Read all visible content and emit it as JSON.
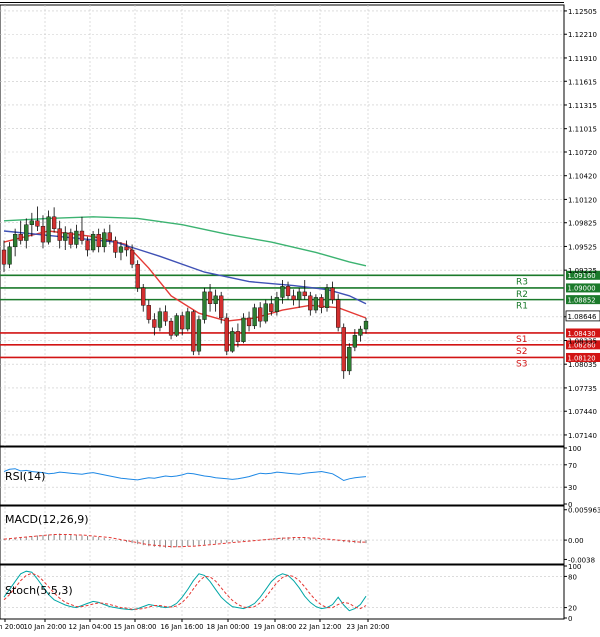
{
  "colors": {
    "frame": "#000000",
    "grid": "#c8c8c8",
    "bull": "#2e7d32",
    "bear": "#d32f2f",
    "wick": "#000000",
    "ma_red": "#e53935",
    "ma_blue": "#3f51b5",
    "ma_green": "#3cb371",
    "resistance": "#1b7a2b",
    "support": "#d21414",
    "rsi_line": "#1e88e5",
    "macd_signal": "#e53935",
    "macd_hist": "#888888",
    "stoch_k": "#00a6a6",
    "stoch_d": "#e53935"
  },
  "chart_data": [
    {
      "type": "candlestick",
      "panel": "price",
      "y_ticks": [
        "1.12505",
        "1.12210",
        "1.11910",
        "1.11615",
        "1.11315",
        "1.11015",
        "1.10720",
        "1.10420",
        "1.10120",
        "1.09825",
        "1.09525",
        "1.09225",
        "1.08635",
        "1.08335",
        "1.08035",
        "1.07735",
        "1.07440",
        "1.07140"
      ],
      "ylim": [
        1.07,
        1.1258
      ],
      "x_ticks": [
        "9 Jan 20:00",
        "10 Jan 20:00",
        "12 Jan 04:00",
        "15 Jan 08:00",
        "16 Jan 16:00",
        "18 Jan 00:00",
        "19 Jan 08:00",
        "22 Jan 12:00",
        "23 Jan 20:00"
      ],
      "candles": [
        [
          1.0948,
          1.096,
          1.092,
          1.093
        ],
        [
          1.093,
          1.0958,
          1.0925,
          1.0952
        ],
        [
          1.0952,
          1.0975,
          1.094,
          1.0968
        ],
        [
          1.0968,
          1.0985,
          1.0955,
          1.096
        ],
        [
          1.096,
          1.0988,
          1.095,
          1.098
        ],
        [
          1.098,
          1.0995,
          1.0965,
          1.0985
        ],
        [
          1.0985,
          1.1003,
          1.0972,
          1.0978
        ],
        [
          1.0978,
          1.0992,
          1.095,
          1.0958
        ],
        [
          1.0958,
          1.0998,
          1.0955,
          1.099
        ],
        [
          1.099,
          1.1002,
          1.097,
          1.0975
        ],
        [
          1.0975,
          1.0985,
          1.095,
          1.096
        ],
        [
          1.096,
          1.0978,
          1.0948,
          1.097
        ],
        [
          1.097,
          1.0975,
          1.095,
          1.0955
        ],
        [
          1.0955,
          1.098,
          1.095,
          1.0972
        ],
        [
          1.0972,
          1.099,
          1.0955,
          1.096
        ],
        [
          1.096,
          1.0965,
          1.094,
          1.0948
        ],
        [
          1.0948,
          1.0972,
          1.0945,
          1.0968
        ],
        [
          1.0968,
          1.0975,
          1.0945,
          1.0952
        ],
        [
          1.0952,
          1.0975,
          1.0945,
          1.097
        ],
        [
          1.097,
          1.098,
          1.0955,
          1.096
        ],
        [
          1.096,
          1.0965,
          1.0938,
          1.0945
        ],
        [
          1.0945,
          1.0958,
          1.0935,
          1.0952
        ],
        [
          1.0952,
          1.096,
          1.094,
          1.0948
        ],
        [
          1.0948,
          1.0955,
          1.0925,
          1.093
        ],
        [
          1.093,
          1.0935,
          1.0895,
          1.09
        ],
        [
          1.09,
          1.0905,
          1.087,
          1.0878
        ],
        [
          1.0878,
          1.0885,
          1.0855,
          1.086
        ],
        [
          1.086,
          1.0868,
          1.084,
          1.085
        ],
        [
          1.085,
          1.0875,
          1.0845,
          1.087
        ],
        [
          1.087,
          1.0878,
          1.0852,
          1.0858
        ],
        [
          1.0858,
          1.0862,
          1.0835,
          1.084
        ],
        [
          1.084,
          1.0868,
          1.0838,
          1.0865
        ],
        [
          1.0865,
          1.087,
          1.084,
          1.0848
        ],
        [
          1.0848,
          1.0875,
          1.0845,
          1.087
        ],
        [
          1.087,
          1.0872,
          1.0815,
          1.082
        ],
        [
          1.082,
          1.0865,
          1.0815,
          1.086
        ],
        [
          1.086,
          1.09,
          1.0855,
          1.0895
        ],
        [
          1.0895,
          1.0905,
          1.087,
          1.088
        ],
        [
          1.088,
          1.0898,
          1.087,
          1.089
        ],
        [
          1.089,
          1.0895,
          1.0855,
          1.0862
        ],
        [
          1.0862,
          1.0868,
          1.0815,
          1.082
        ],
        [
          1.082,
          1.085,
          1.0818,
          1.0845
        ],
        [
          1.0845,
          1.0855,
          1.0825,
          1.0832
        ],
        [
          1.0832,
          1.0868,
          1.083,
          1.0862
        ],
        [
          1.0862,
          1.087,
          1.0845,
          1.0852
        ],
        [
          1.0852,
          1.088,
          1.0848,
          1.0875
        ],
        [
          1.0875,
          1.0882,
          1.085,
          1.0858
        ],
        [
          1.0858,
          1.0885,
          1.0855,
          1.088
        ],
        [
          1.088,
          1.089,
          1.0865,
          1.087
        ],
        [
          1.087,
          1.0895,
          1.0865,
          1.0888
        ],
        [
          1.0888,
          1.091,
          1.088,
          1.0902
        ],
        [
          1.0902,
          1.0908,
          1.0885,
          1.089
        ],
        [
          1.089,
          1.0898,
          1.0878,
          1.0885
        ],
        [
          1.0885,
          1.09,
          1.0875,
          1.0895
        ],
        [
          1.0895,
          1.091,
          1.0885,
          1.089
        ],
        [
          1.089,
          1.0895,
          1.0865,
          1.0872
        ],
        [
          1.0872,
          1.0892,
          1.0868,
          1.0888
        ],
        [
          1.0888,
          1.0892,
          1.0868,
          1.0875
        ],
        [
          1.0875,
          1.0905,
          1.087,
          1.09
        ],
        [
          1.09,
          1.0908,
          1.088,
          1.0885
        ],
        [
          1.0885,
          1.0892,
          1.0845,
          1.085
        ],
        [
          1.085,
          1.0855,
          1.0785,
          1.0795
        ],
        [
          1.0795,
          1.083,
          1.079,
          1.0825
        ],
        [
          1.0825,
          1.0848,
          1.082,
          1.084
        ],
        [
          1.084,
          1.0852,
          1.0832,
          1.0848
        ],
        [
          1.0848,
          1.0862,
          1.0842,
          1.0858
        ]
      ],
      "moving_averages": [
        {
          "color": "ma_red",
          "points": [
            [
              0,
              1.0958
            ],
            [
              8,
              1.0972
            ],
            [
              16,
              1.0965
            ],
            [
              22,
              1.0955
            ],
            [
              26,
              1.0925
            ],
            [
              30,
              1.089
            ],
            [
              35,
              1.0868
            ],
            [
              40,
              1.0858
            ],
            [
              45,
              1.0862
            ],
            [
              50,
              1.0872
            ],
            [
              55,
              1.0878
            ],
            [
              60,
              1.0875
            ],
            [
              65,
              1.0862
            ]
          ]
        },
        {
          "color": "ma_blue",
          "points": [
            [
              0,
              1.0972
            ],
            [
              10,
              1.0965
            ],
            [
              20,
              1.0958
            ],
            [
              28,
              1.094
            ],
            [
              36,
              1.092
            ],
            [
              44,
              1.0908
            ],
            [
              52,
              1.0903
            ],
            [
              58,
              1.0898
            ],
            [
              62,
              1.089
            ],
            [
              65,
              1.088
            ]
          ]
        },
        {
          "color": "ma_green",
          "points": [
            [
              0,
              1.0985
            ],
            [
              8,
              1.0988
            ],
            [
              16,
              1.099
            ],
            [
              24,
              1.0988
            ],
            [
              32,
              1.098
            ],
            [
              40,
              1.0968
            ],
            [
              48,
              1.0958
            ],
            [
              56,
              1.0945
            ],
            [
              62,
              1.0933
            ],
            [
              65,
              1.0928
            ]
          ]
        }
      ],
      "levels": [
        {
          "name": "R3",
          "value": 1.0916,
          "label": "1.09160",
          "kind": "resistance"
        },
        {
          "name": "R2",
          "value": 1.09,
          "label": "1.09000",
          "kind": "resistance"
        },
        {
          "name": "R1",
          "value": 1.08852,
          "label": "1.08852",
          "kind": "resistance"
        },
        {
          "name": "S1",
          "value": 1.0843,
          "label": "1.08430",
          "kind": "support"
        },
        {
          "name": "S2",
          "value": 1.0828,
          "label": "1.08280",
          "kind": "support"
        },
        {
          "name": "S3",
          "value": 1.0812,
          "label": "1.08120",
          "kind": "support"
        }
      ],
      "current_price": "1.08646",
      "current_value": 1.08646
    },
    {
      "type": "line",
      "panel": "rsi",
      "title": "RSI(14)",
      "y_ticks": [
        "100",
        "70",
        "30",
        "0"
      ],
      "ylim": [
        0,
        100
      ],
      "values": [
        58,
        62,
        63,
        59,
        60,
        58,
        57,
        56,
        54,
        55,
        57,
        56,
        55,
        54,
        53,
        55,
        56,
        54,
        52,
        50,
        48,
        46,
        45,
        44,
        43,
        45,
        47,
        46,
        48,
        50,
        49,
        50,
        52,
        55,
        54,
        52,
        50,
        49,
        47,
        46,
        45,
        44,
        45,
        47,
        49,
        52,
        55,
        54,
        55,
        57,
        56,
        55,
        54,
        53,
        55,
        56,
        57,
        58,
        56,
        54,
        48,
        42,
        45,
        47,
        48,
        49
      ]
    },
    {
      "type": "bar",
      "panel": "macd",
      "title": "MACD(12,26,9)",
      "y_ticks": [
        "0.005963",
        "0.00",
        "-0.0038"
      ],
      "ylim": [
        -0.0045,
        0.0065
      ],
      "histogram": [
        0.0003,
        0.0004,
        0.0005,
        0.0006,
        0.0007,
        0.0008,
        0.0009,
        0.001,
        0.0011,
        0.0012,
        0.0013,
        0.0012,
        0.0011,
        0.001,
        0.0009,
        0.0008,
        0.0007,
        0.0006,
        0.0004,
        0.0002,
        0.0,
        -0.0002,
        -0.0004,
        -0.0006,
        -0.0008,
        -0.001,
        -0.0012,
        -0.0013,
        -0.0014,
        -0.0015,
        -0.0015,
        -0.0014,
        -0.0013,
        -0.0012,
        -0.0011,
        -0.001,
        -0.0009,
        -0.0008,
        -0.0007,
        -0.0006,
        -0.0005,
        -0.0004,
        -0.0003,
        -0.0002,
        -0.0001,
        0.0,
        0.0001,
        0.0002,
        0.0003,
        0.0004,
        0.0005,
        0.0006,
        0.0006,
        0.0006,
        0.0005,
        0.0004,
        0.0003,
        0.0002,
        0.0001,
        0.0,
        -0.0002,
        -0.0004,
        -0.0005,
        -0.0006,
        -0.0006,
        -0.0006
      ],
      "signal": [
        0.0002,
        0.0003,
        0.0004,
        0.0005,
        0.0006,
        0.0007,
        0.0008,
        0.0009,
        0.001,
        0.0011,
        0.0011,
        0.0011,
        0.0011,
        0.001,
        0.001,
        0.0009,
        0.0008,
        0.0007,
        0.0006,
        0.0005,
        0.0003,
        0.0001,
        -0.0001,
        -0.0003,
        -0.0005,
        -0.0007,
        -0.0009,
        -0.001,
        -0.0011,
        -0.0012,
        -0.0013,
        -0.0013,
        -0.0013,
        -0.0012,
        -0.0012,
        -0.0011,
        -0.001,
        -0.0009,
        -0.0008,
        -0.0007,
        -0.0006,
        -0.0005,
        -0.0004,
        -0.0003,
        -0.0002,
        -0.0001,
        0.0,
        0.0001,
        0.0002,
        0.0003,
        0.0004,
        0.0004,
        0.0005,
        0.0005,
        0.0005,
        0.0004,
        0.0004,
        0.0003,
        0.0002,
        0.0001,
        0.0,
        -0.0001,
        -0.0002,
        -0.0003,
        -0.0004,
        -0.0004
      ]
    },
    {
      "type": "line",
      "panel": "stoch",
      "title": "Stoch(5,5,3)",
      "y_ticks": [
        "100",
        "80",
        "20",
        "0"
      ],
      "ylim": [
        0,
        100
      ],
      "k": [
        40,
        55,
        70,
        85,
        90,
        88,
        75,
        60,
        45,
        35,
        30,
        25,
        22,
        20,
        24,
        28,
        32,
        30,
        26,
        22,
        20,
        18,
        17,
        16,
        18,
        22,
        26,
        24,
        22,
        20,
        22,
        28,
        40,
        55,
        72,
        85,
        82,
        70,
        55,
        40,
        30,
        22,
        20,
        18,
        22,
        28,
        40,
        55,
        70,
        80,
        85,
        82,
        72,
        58,
        42,
        30,
        22,
        18,
        20,
        26,
        40,
        25,
        14,
        18,
        26,
        42
      ],
      "d": [
        35,
        45,
        58,
        72,
        82,
        86,
        82,
        72,
        60,
        48,
        38,
        30,
        26,
        22,
        22,
        24,
        27,
        29,
        28,
        26,
        23,
        20,
        19,
        17,
        17,
        18,
        21,
        24,
        24,
        22,
        21,
        23,
        30,
        41,
        56,
        70,
        80,
        79,
        71,
        58,
        45,
        34,
        26,
        21,
        20,
        22,
        29,
        40,
        54,
        68,
        78,
        82,
        80,
        72,
        60,
        46,
        34,
        25,
        20,
        20,
        26,
        30,
        28,
        21,
        18,
        24
      ]
    }
  ]
}
